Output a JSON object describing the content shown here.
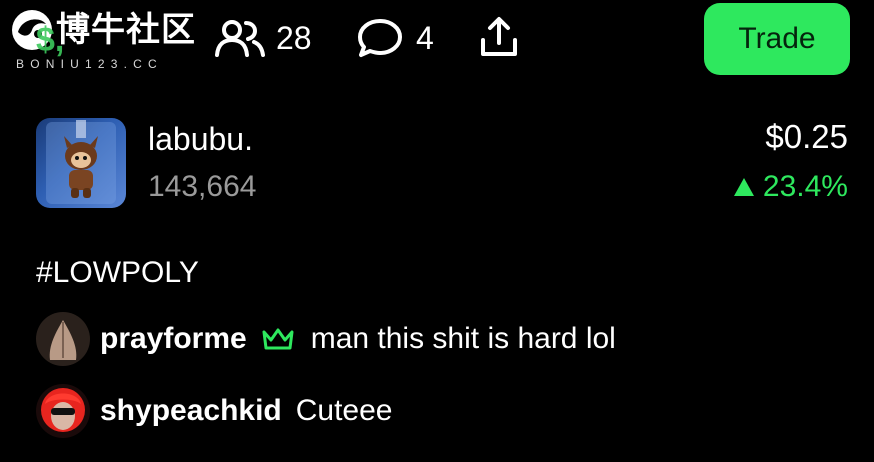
{
  "watermark": {
    "title": "博牛社区",
    "subtitle": "BONIU123.CC"
  },
  "header": {
    "partial_value": "$,",
    "holders_count": "28",
    "comments_count": "4",
    "trade_label": "Trade"
  },
  "token": {
    "name": "labubu.",
    "count": "143,664",
    "price": "$0.25",
    "change": "23.4%",
    "change_direction": "up"
  },
  "hashtag": "#LOWPOLY",
  "comments": [
    {
      "user": "prayforme",
      "badge": "crown-icon",
      "text": "man this shit is hard  lol"
    },
    {
      "user": "shypeachkid",
      "text": "Cuteee"
    }
  ],
  "colors": {
    "accent_green": "#2ee85e",
    "background": "#000000",
    "muted_text": "#9a9a9a"
  }
}
